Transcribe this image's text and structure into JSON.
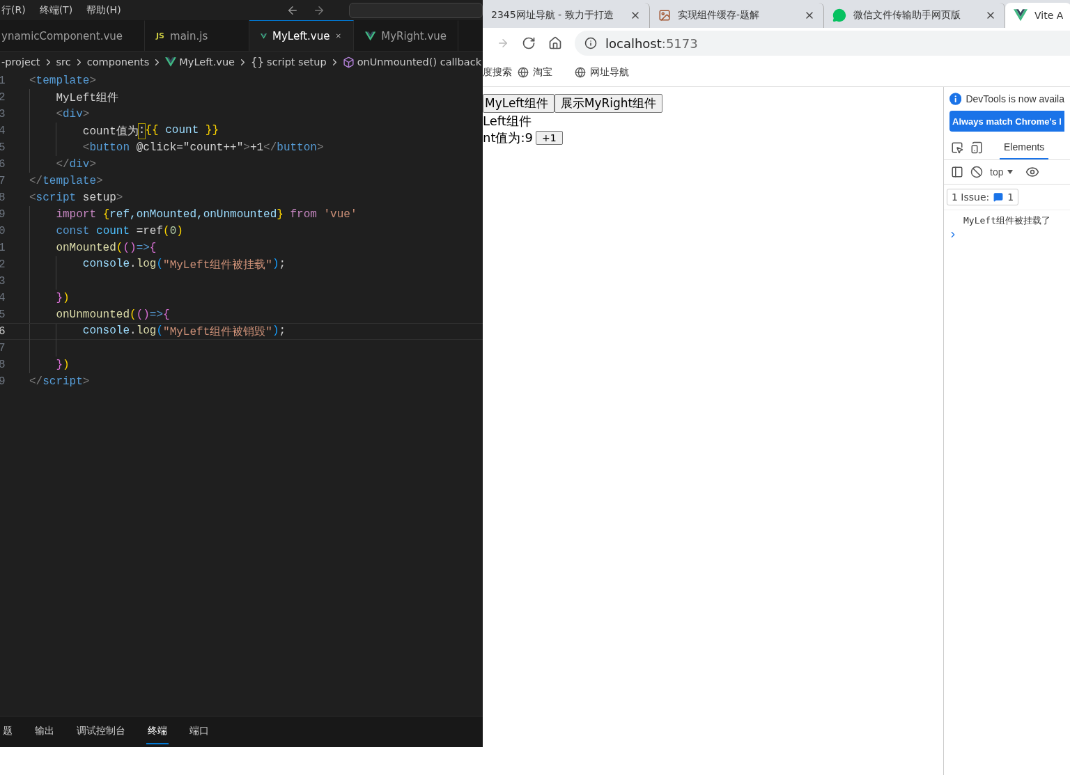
{
  "editor": {
    "menu": [
      "行(R)",
      "终端(T)",
      "帮助(H)"
    ],
    "tabs": [
      {
        "label": "ynamicComponent.vue",
        "selected": false
      },
      {
        "label": "main.js",
        "badge": "JS",
        "selected": false
      },
      {
        "label": "MyLeft.vue",
        "selected": true
      },
      {
        "label": "MyRight.vue",
        "selected": false
      }
    ],
    "breadcrumb": [
      {
        "label": "-project"
      },
      {
        "label": "src"
      },
      {
        "label": "components"
      },
      {
        "label": "MyLeft.vue"
      },
      {
        "label": "script setup",
        "glyph": "{}"
      },
      {
        "label": "onUnmounted() callback"
      }
    ],
    "lines": [
      {
        "number": "1",
        "active": false,
        "tokens": [
          {
            "text": "<",
            "kind": "punct"
          },
          {
            "text": "template",
            "kind": "tag"
          },
          {
            "text": ">",
            "kind": "punct"
          }
        ]
      },
      {
        "number": "2",
        "active": false,
        "tokens": [
          {
            "text": "    MyLeft组件",
            "kind": "plain"
          }
        ]
      },
      {
        "number": "3",
        "active": false,
        "tokens": [
          {
            "text": "    <",
            "kind": "punct"
          },
          {
            "text": "div",
            "kind": "tag"
          },
          {
            "text": ">",
            "kind": "punct"
          }
        ]
      },
      {
        "number": "4",
        "active": false,
        "tokens": [
          {
            "text": "        count值为",
            "kind": "plain"
          },
          {
            "text": ":",
            "kind": "match"
          },
          {
            "text": "{{",
            "kind": "gold"
          },
          {
            "text": " count ",
            "kind": "var"
          },
          {
            "text": "}}",
            "kind": "gold"
          }
        ]
      },
      {
        "number": "5",
        "active": false,
        "tokens": [
          {
            "text": "        <",
            "kind": "punct"
          },
          {
            "text": "button",
            "kind": "tag"
          },
          {
            "text": " @click=\"count++\"",
            "kind": "plain"
          },
          {
            "text": ">",
            "kind": "punct"
          },
          {
            "text": "+1",
            "kind": "plain"
          },
          {
            "text": "</",
            "kind": "punct"
          },
          {
            "text": "button",
            "kind": "tag"
          },
          {
            "text": ">",
            "kind": "punct"
          }
        ]
      },
      {
        "number": "6",
        "active": false,
        "tokens": [
          {
            "text": "    </",
            "kind": "punct"
          },
          {
            "text": "div",
            "kind": "tag"
          },
          {
            "text": ">",
            "kind": "punct"
          }
        ]
      },
      {
        "number": "7",
        "active": false,
        "tokens": [
          {
            "text": "</",
            "kind": "punct"
          },
          {
            "text": "template",
            "kind": "tag"
          },
          {
            "text": ">",
            "kind": "punct"
          }
        ]
      },
      {
        "number": "8",
        "active": false,
        "tokens": [
          {
            "text": "<",
            "kind": "punct"
          },
          {
            "text": "script",
            "kind": "tag"
          },
          {
            "text": " setup",
            "kind": "plain"
          },
          {
            "text": ">",
            "kind": "punct"
          }
        ]
      },
      {
        "number": "9",
        "active": false,
        "tokens": [
          {
            "text": "    import ",
            "kind": "keyword"
          },
          {
            "text": "{",
            "kind": "gold"
          },
          {
            "text": "ref,onMounted,onUnmounted",
            "kind": "var"
          },
          {
            "text": "}",
            "kind": "gold"
          },
          {
            "text": " from ",
            "kind": "keyword"
          },
          {
            "text": "'vue'",
            "kind": "string"
          }
        ]
      },
      {
        "number": "0",
        "active": false,
        "tokens": [
          {
            "text": "    const",
            "kind": "storage"
          },
          {
            "text": " count",
            "kind": "const"
          },
          {
            "text": " =ref",
            "kind": "plain"
          },
          {
            "text": "(",
            "kind": "gold"
          },
          {
            "text": "0",
            "kind": "number"
          },
          {
            "text": ")",
            "kind": "gold"
          }
        ]
      },
      {
        "number": "1",
        "active": false,
        "tokens": [
          {
            "text": "    onMounted",
            "kind": "func"
          },
          {
            "text": "(",
            "kind": "gold"
          },
          {
            "text": "()",
            "kind": "pink"
          },
          {
            "text": "=>",
            "kind": "storage"
          },
          {
            "text": "{",
            "kind": "pink"
          }
        ]
      },
      {
        "number": "2",
        "active": false,
        "tokens": [
          {
            "text": "        console",
            "kind": "var"
          },
          {
            "text": ".",
            "kind": "plain"
          },
          {
            "text": "log",
            "kind": "func"
          },
          {
            "text": "(",
            "kind": "blue"
          },
          {
            "text": "\"MyLeft组件被挂载\"",
            "kind": "string"
          },
          {
            "text": ")",
            "kind": "blue"
          },
          {
            "text": ";",
            "kind": "plain"
          }
        ]
      },
      {
        "number": "3",
        "active": false
      },
      {
        "number": "4",
        "active": false,
        "tokens": [
          {
            "text": "    }",
            "kind": "pink"
          },
          {
            "text": ")",
            "kind": "gold"
          }
        ]
      },
      {
        "number": "5",
        "active": false,
        "tokens": [
          {
            "text": "    onUnmounted",
            "kind": "func"
          },
          {
            "text": "(",
            "kind": "gold"
          },
          {
            "text": "()",
            "kind": "pink"
          },
          {
            "text": "=>",
            "kind": "storage"
          },
          {
            "text": "{",
            "kind": "pink"
          }
        ]
      },
      {
        "number": "6",
        "active": true,
        "tokens": [
          {
            "text": "        console",
            "kind": "var"
          },
          {
            "text": ".",
            "kind": "plain"
          },
          {
            "text": "log",
            "kind": "func"
          },
          {
            "text": "(",
            "kind": "blue"
          },
          {
            "text": "\"MyLeft组件被销毁\"",
            "kind": "string"
          },
          {
            "text": ")",
            "kind": "blue"
          },
          {
            "text": ";",
            "kind": "plain"
          }
        ]
      },
      {
        "number": "7",
        "active": false
      },
      {
        "number": "8",
        "active": false,
        "tokens": [
          {
            "text": "    }",
            "kind": "pink"
          },
          {
            "text": ")",
            "kind": "gold"
          }
        ]
      },
      {
        "number": "9",
        "active": false,
        "tokens": [
          {
            "text": "</",
            "kind": "punct"
          },
          {
            "text": "script",
            "kind": "tag"
          },
          {
            "text": ">",
            "kind": "punct"
          }
        ]
      }
    ],
    "panel_tabs": [
      {
        "label": "题",
        "selected": false
      },
      {
        "label": "输出",
        "selected": false
      },
      {
        "label": "调试控制台",
        "selected": false
      },
      {
        "label": "终端",
        "selected": true
      },
      {
        "label": "端口",
        "selected": false
      }
    ]
  },
  "browser": {
    "tabs": [
      {
        "title": "2345网址导航 - 致力于打造",
        "selected": false
      },
      {
        "title": "实现组件缓存-题解",
        "selected": false
      },
      {
        "title": "微信文件传输助手网页版",
        "selected": false
      },
      {
        "title": "Vite A",
        "selected": true
      }
    ],
    "address": {
      "host": "localhost",
      "port": ":5173"
    },
    "bookmarks": [
      "度搜索",
      "淘宝",
      "网址导航"
    ],
    "page": {
      "buttons": [
        "MyLeft组件",
        "展示MyRight组件"
      ],
      "title": "Left组件",
      "count": "nt值为:9",
      "increment": "+1"
    },
    "devtools": {
      "notice": "DevTools is now availa",
      "match_button": "Always match Chrome's l",
      "tab": "Elements",
      "context": "top",
      "issues": {
        "label": "1 Issue:",
        "count": "1"
      },
      "messages": [
        "MyLeft组件被挂载了"
      ]
    }
  }
}
